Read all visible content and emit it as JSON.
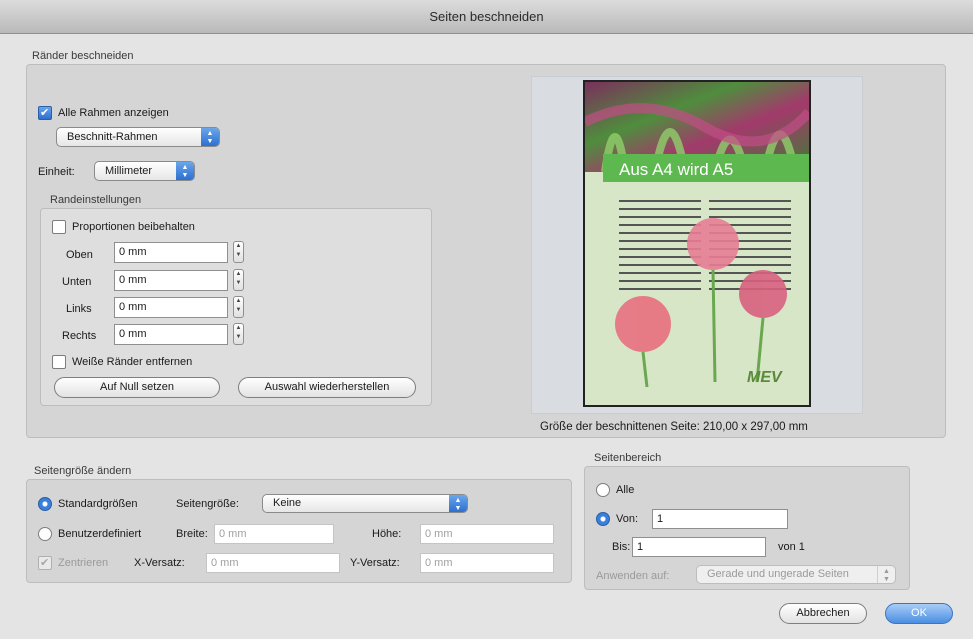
{
  "window": {
    "title": "Seiten beschneiden"
  },
  "crop": {
    "group_label": "Ränder beschneiden",
    "show_all_frames": {
      "label": "Alle Rahmen anzeigen",
      "checked": true
    },
    "frame_popup": {
      "value": "Beschnitt-Rahmen"
    },
    "unit": {
      "label": "Einheit:",
      "value": "Millimeter"
    },
    "margins": {
      "group_label": "Randeinstellungen",
      "keep_proportions": {
        "label": "Proportionen beibehalten",
        "checked": false
      },
      "top": {
        "label": "Oben",
        "value": "0 mm"
      },
      "bottom": {
        "label": "Unten",
        "value": "0 mm"
      },
      "left": {
        "label": "Links",
        "value": "0 mm"
      },
      "right": {
        "label": "Rechts",
        "value": "0 mm"
      },
      "remove_white": {
        "label": "Weiße Ränder entfernen",
        "checked": false
      },
      "reset_button": "Auf Null setzen",
      "restore_button": "Auswahl wiederherstellen"
    }
  },
  "preview": {
    "headline": "Aus A4 wird A5",
    "logo": "MEV",
    "size_caption": "Größe der beschnittenen Seite: 210,00 x 297,00 mm"
  },
  "page_size": {
    "group_label": "Seitengröße ändern",
    "standard": {
      "label": "Standardgrößen",
      "selected": true
    },
    "page_size_label": "Seitengröße:",
    "page_size_value": "Keine",
    "custom": {
      "label": "Benutzerdefiniert",
      "selected": false
    },
    "width_label": "Breite:",
    "width_value": "0 mm",
    "height_label": "Höhe:",
    "height_value": "0 mm",
    "center": {
      "label": "Zentrieren",
      "checked": true,
      "disabled": true
    },
    "x_offset_label": "X-Versatz:",
    "x_offset_value": "0 mm",
    "y_offset_label": "Y-Versatz:",
    "y_offset_value": "0 mm"
  },
  "page_range": {
    "group_label": "Seitenbereich",
    "all": {
      "label": "Alle",
      "selected": false
    },
    "from": {
      "label": "Von:",
      "value": "1",
      "selected": true
    },
    "to": {
      "label": "Bis:",
      "value": "1"
    },
    "of_label": "von 1",
    "apply_label": "Anwenden auf:",
    "apply_value": "Gerade und ungerade Seiten"
  },
  "buttons": {
    "cancel": "Abbrechen",
    "ok": "OK"
  },
  "colors": {
    "accent": "#3b7fdc",
    "preview_green": "#5db84f",
    "page_bg": "#d8e6c8"
  }
}
